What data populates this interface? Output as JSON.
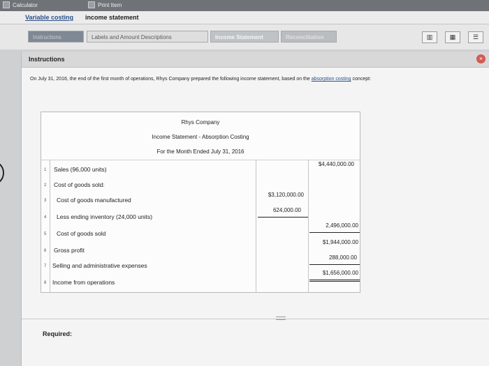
{
  "topbar": {
    "calculator": "Calculator",
    "print_item": "Print Item"
  },
  "title": {
    "link": "Variable costing",
    "rest": "income statement"
  },
  "tabs": [
    {
      "label": "Instructions"
    },
    {
      "label": "Labels and Amount Descriptions"
    },
    {
      "label": "Income Statement"
    },
    {
      "label": "Reconciliation"
    }
  ],
  "panel": {
    "heading": "Instructions"
  },
  "intro": {
    "text": "On July 31, 2016, the end of the first month of operations, Rhys Company prepared the following income statement, based on the",
    "link": "absorption costing",
    "tail": "concept:"
  },
  "statement": {
    "company": "Rhys Company",
    "title": "Income Statement - Absorption Costing",
    "period": "For the Month Ended July 31, 2016",
    "rows": [
      {
        "num": "1",
        "label": "Sales (96,000 units)",
        "col1": "",
        "col2": "$4,440,000.00"
      },
      {
        "num": "2",
        "label": "Cost of goods sold:",
        "col1": "",
        "col2": ""
      },
      {
        "num": "3",
        "label": "Cost of goods manufactured",
        "col1": "$3,120,000.00",
        "col2": ""
      },
      {
        "num": "4",
        "label": "Less ending inventory (24,000 units)",
        "col1": "624,000.00",
        "col2": ""
      },
      {
        "num": "5",
        "label": "Cost of goods sold",
        "col1": "",
        "col2": "2,496,000.00"
      },
      {
        "num": "6",
        "label": "Gross profit",
        "col1": "",
        "col2": "$1,944,000.00"
      },
      {
        "num": "7",
        "label": "Selling and administrative expenses",
        "col1": "",
        "col2": "288,000.00"
      },
      {
        "num": "8",
        "label": "Income from operations",
        "col1": "",
        "col2": "$1,656,000.00"
      }
    ]
  },
  "required": "Required:"
}
